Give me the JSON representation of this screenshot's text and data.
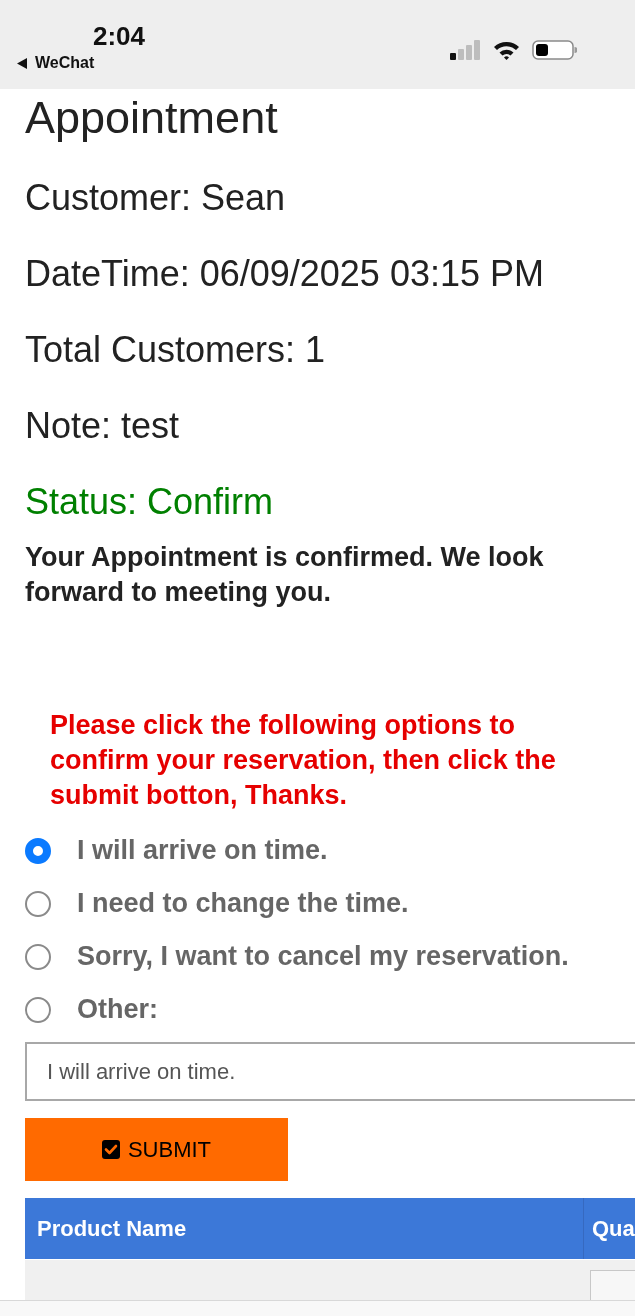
{
  "status_bar": {
    "time": "2:04",
    "back_label": "WeChat"
  },
  "appointment": {
    "title": "Appointment",
    "fields": [
      "Customer: Sean",
      "DateTime: 06/09/2025 03:15 PM",
      "Total Customers: 1",
      "Note: test"
    ],
    "status": "Status: Confirm",
    "message": "Your Appointment is confirmed. We look forward to meeting you."
  },
  "instructions": "Please click the following options to confirm your reservation, then click the submit botton, Thanks.",
  "options": [
    {
      "label": "I will arrive on time.",
      "selected": true
    },
    {
      "label": "I need to change the time.",
      "selected": false
    },
    {
      "label": "Sorry, I want to cancel my reservation.",
      "selected": false
    },
    {
      "label": "Other:",
      "selected": false
    }
  ],
  "note_field": {
    "value": "I will arrive on time."
  },
  "submit_button": {
    "label": "SUBMIT"
  },
  "table": {
    "columns": [
      "Product Name",
      "Qua"
    ]
  }
}
